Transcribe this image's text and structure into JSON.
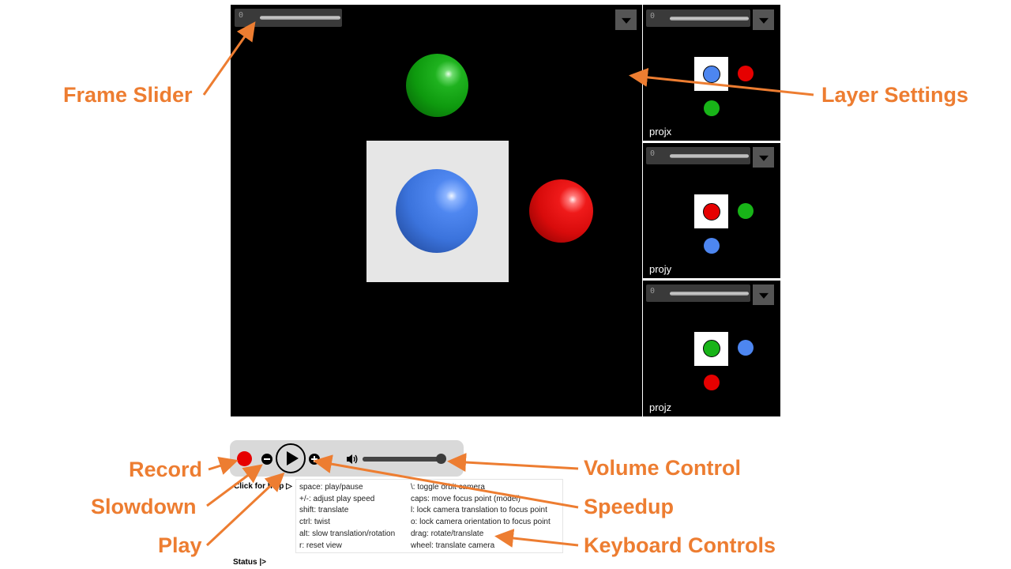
{
  "main_view": {
    "frame_slider_value": "0"
  },
  "side_panels": [
    {
      "label": "projx",
      "slider_value": "0"
    },
    {
      "label": "projy",
      "slider_value": "0"
    },
    {
      "label": "projz",
      "slider_value": "0"
    }
  ],
  "annotations": {
    "frame_slider": "Frame Slider",
    "layer_settings": "Layer Settings",
    "record": "Record",
    "slowdown": "Slowdown",
    "play": "Play",
    "volume_control": "Volume Control",
    "speedup": "Speedup",
    "keyboard_controls": "Keyboard Controls"
  },
  "controls": {
    "help_toggle": "Click for help ▷",
    "status": "Status |>",
    "volume_level": 1.0
  },
  "help_left": [
    "space: play/pause",
    "+/-: adjust play speed",
    "shift: translate",
    "ctrl: twist",
    "alt: slow translation/rotation",
    "r: reset view"
  ],
  "help_right": [
    "\\: toggle orbit camera",
    "caps: move focus point (model)",
    "l: lock camera translation to focus point",
    "o: lock camera orientation to focus point",
    "drag: rotate/translate",
    "wheel: translate camera"
  ],
  "colors": {
    "annotation": "#ed7d31",
    "red": "#e60000",
    "green": "#18b418",
    "blue": "#4d86f0"
  }
}
